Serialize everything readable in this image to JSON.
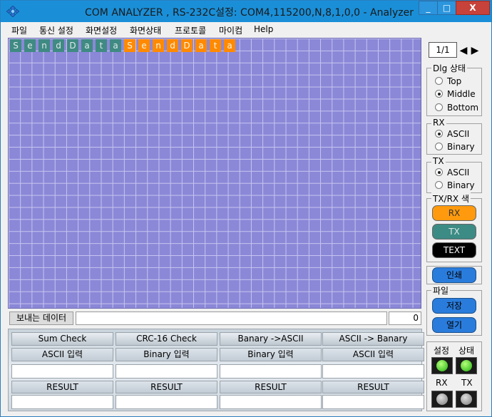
{
  "window": {
    "title": "COM ANALYZER , RS-232C설정: COM4,115200,N,8,1,0,0  - Analyzer",
    "controls": [
      "_",
      "□",
      "X"
    ]
  },
  "menu": [
    "파일",
    "통신 설정",
    "화면설정",
    "화면상태",
    "프로토콜",
    "마이컴",
    "Help"
  ],
  "data_cells": {
    "tx": [
      "S",
      "e",
      "n",
      "d",
      "D",
      "a",
      "t",
      "a"
    ],
    "rx": [
      "S",
      "e",
      "n",
      "d",
      "D",
      "a",
      "t",
      "a"
    ]
  },
  "send_bar": {
    "label": "보내는 데이터",
    "value": "",
    "count": "0"
  },
  "tools": [
    {
      "button": "Sum Check",
      "input_label": "ASCII 입력",
      "result_label": "RESULT"
    },
    {
      "button": "CRC-16 Check",
      "input_label": "Binary 입력",
      "result_label": "RESULT"
    },
    {
      "button": "Banary ->ASCII",
      "input_label": "Binary 입력",
      "result_label": "RESULT"
    },
    {
      "button": "ASCII -> Banary",
      "input_label": "ASCII 입력",
      "result_label": "RESULT"
    }
  ],
  "side": {
    "page": "1/1",
    "dlg_group": {
      "title": "Dlg 상태",
      "options": [
        "Top",
        "Middle",
        "Bottom"
      ],
      "selected": "Middle"
    },
    "rx_group": {
      "title": "RX",
      "options": [
        "ASCII",
        "Binary"
      ],
      "selected": "ASCII"
    },
    "tx_group": {
      "title": "TX",
      "options": [
        "ASCII",
        "Binary"
      ],
      "selected": "ASCII"
    },
    "color_group": {
      "title": "TX/RX 색",
      "buttons": [
        "RX",
        "TX",
        "TEXT"
      ]
    },
    "print_button": "인쇄",
    "file_group": {
      "title": "파일",
      "buttons": [
        "저장",
        "열기"
      ]
    },
    "status": {
      "labels": [
        "설정",
        "상태",
        "RX",
        "TX"
      ]
    }
  },
  "colors": {
    "grid_bg": "#8b88d8",
    "tx_cell": "#3f8a83",
    "rx_cell": "#ff8a00",
    "title_bar": "#1a8fd8"
  }
}
